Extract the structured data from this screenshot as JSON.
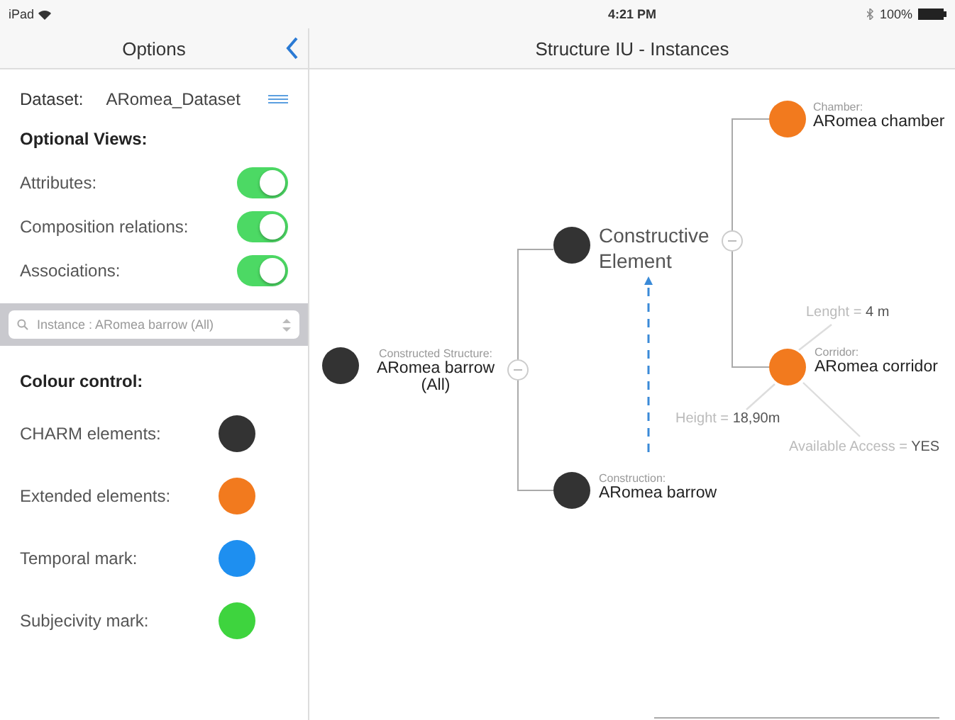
{
  "status_bar": {
    "device": "iPad",
    "time": "4:21 PM",
    "battery": "100%"
  },
  "sidebar": {
    "title": "Options",
    "dataset_label": "Dataset:",
    "dataset_value": "ARomea_Dataset",
    "optional_views_title": "Optional Views:",
    "toggles": [
      {
        "label": "Attributes:",
        "on": true
      },
      {
        "label": "Composition relations:",
        "on": true
      },
      {
        "label": "Associations:",
        "on": true
      }
    ],
    "search": {
      "value": "Instance : ARomea barrow (All)"
    },
    "colour_title": "Colour control:",
    "colours": [
      {
        "label": "CHARM elements:",
        "color": "#333333"
      },
      {
        "label": "Extended elements:",
        "color": "#f27a1e"
      },
      {
        "label": "Temporal mark:",
        "color": "#1e8ff0"
      },
      {
        "label": "Subjecivity mark:",
        "color": "#3ed43e"
      }
    ]
  },
  "main": {
    "title": "Structure IU - Instances",
    "nodes": [
      {
        "kind": "instance",
        "caption": "Constructed Structure:",
        "name": "ARomea barrow (All)",
        "color": "#333333"
      },
      {
        "kind": "category",
        "name": "Constructive Element",
        "color": "#333333"
      },
      {
        "kind": "instance",
        "caption": "Chamber:",
        "name": "ARomea chamber",
        "color": "#f27a1e"
      },
      {
        "kind": "instance",
        "caption": "Corridor:",
        "name": "ARomea corridor",
        "color": "#f27a1e"
      },
      {
        "kind": "instance",
        "caption": "Construction:",
        "name": "ARomea barrow",
        "color": "#333333"
      }
    ],
    "attributes": [
      {
        "text": "Lenght = **4 m**"
      },
      {
        "text": "Height = **18,90m**"
      },
      {
        "text": "Available Access = **YES**"
      }
    ]
  }
}
